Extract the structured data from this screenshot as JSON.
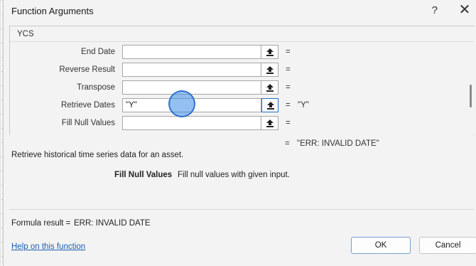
{
  "dialog": {
    "title": "Function Arguments",
    "help_glyph": "?",
    "close_glyph": "✕",
    "function_name": "YCS"
  },
  "arguments": [
    {
      "label": "End Date",
      "value": "",
      "result": ""
    },
    {
      "label": "Reverse Result",
      "value": "",
      "result": ""
    },
    {
      "label": "Transpose",
      "value": "",
      "result": ""
    },
    {
      "label": "Retrieve Dates",
      "value": "\"Y\"",
      "result": "\"Y\""
    },
    {
      "label": "Fill Null Values",
      "value": "",
      "result": ""
    }
  ],
  "equals_sign": "=",
  "function_result": "\"ERR: INVALID DATE\"",
  "function_description": "Retrieve historical time series data for an asset.",
  "current_argument": {
    "name": "Fill Null Values",
    "description": "Fill null values with given input."
  },
  "formula_result": {
    "label": "Formula result =",
    "value": "ERR: INVALID DATE"
  },
  "help_link": "Help on this function",
  "buttons": {
    "ok": "OK",
    "cancel": "Cancel"
  },
  "icons": {
    "ref": "collapse-dialog-icon"
  },
  "colors": {
    "link": "#1b5fb3",
    "active_border": "#1f6fc4",
    "cursor": "#3c8ce6"
  }
}
